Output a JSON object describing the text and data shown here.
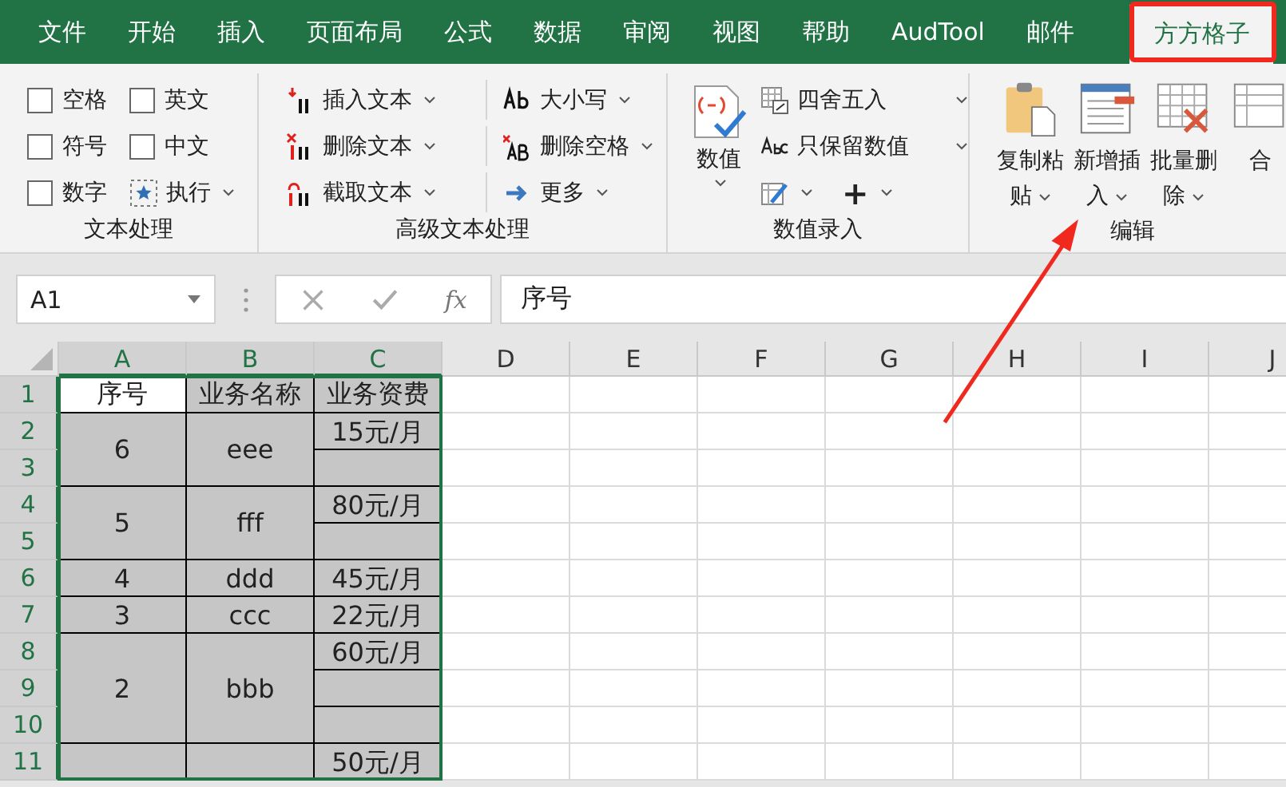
{
  "menu_tabs": [
    {
      "label": "文件",
      "selected": false
    },
    {
      "label": "开始",
      "selected": false
    },
    {
      "label": "插入",
      "selected": false
    },
    {
      "label": "页面布局",
      "selected": false
    },
    {
      "label": "公式",
      "selected": false
    },
    {
      "label": "数据",
      "selected": false
    },
    {
      "label": "审阅",
      "selected": false
    },
    {
      "label": "视图",
      "selected": false
    },
    {
      "label": "帮助",
      "selected": false
    },
    {
      "label": "AudTool",
      "selected": false
    },
    {
      "label": "邮件",
      "selected": false
    },
    {
      "label": "方方格子",
      "selected": true
    }
  ],
  "ribbon": {
    "text_group": {
      "title": "文本处理",
      "items": [
        {
          "kind": "checkbox",
          "label": "空格",
          "checked": false
        },
        {
          "kind": "checkbox",
          "label": "英文",
          "checked": false
        },
        {
          "kind": "checkbox",
          "label": "符号",
          "checked": false
        },
        {
          "kind": "checkbox",
          "label": "中文",
          "checked": false
        },
        {
          "kind": "checkbox",
          "label": "数字",
          "checked": false
        },
        {
          "kind": "button",
          "label": "执行"
        }
      ]
    },
    "advanced_group": {
      "title": "高级文本处理",
      "items": [
        {
          "label": "插入文本"
        },
        {
          "label": "大小写"
        },
        {
          "label": "删除文本"
        },
        {
          "label": "删除空格"
        },
        {
          "label": "截取文本"
        },
        {
          "label": "更多"
        }
      ]
    },
    "number_group": {
      "title": "数值录入",
      "big_button": "数值",
      "items": [
        {
          "kind": "text",
          "label": "四舍五入"
        },
        {
          "kind": "text",
          "label": "只保留数值"
        },
        {
          "kind": "icon"
        },
        {
          "kind": "glyph",
          "label": "+"
        }
      ]
    },
    "edit_group": {
      "title": "编辑",
      "buttons": [
        "复制粘贴",
        "新增插入",
        "批量删除",
        "合"
      ]
    }
  },
  "formula_bar": {
    "name_box": "A1",
    "fx": "fx",
    "formula": "序号"
  },
  "sheet": {
    "columns": [
      {
        "label": "A",
        "selected": true
      },
      {
        "label": "B",
        "selected": true
      },
      {
        "label": "C",
        "selected": true
      },
      {
        "label": "D",
        "selected": false
      },
      {
        "label": "E",
        "selected": false
      },
      {
        "label": "F",
        "selected": false
      },
      {
        "label": "G",
        "selected": false
      },
      {
        "label": "H",
        "selected": false
      },
      {
        "label": "I",
        "selected": false
      },
      {
        "label": "J",
        "selected": false
      }
    ],
    "rows": [
      {
        "label": "1",
        "selected": true
      },
      {
        "label": "2",
        "selected": true
      },
      {
        "label": "3",
        "selected": true
      },
      {
        "label": "4",
        "selected": true
      },
      {
        "label": "5",
        "selected": true
      },
      {
        "label": "6",
        "selected": true
      },
      {
        "label": "7",
        "selected": true
      },
      {
        "label": "8",
        "selected": true
      },
      {
        "label": "9",
        "selected": true
      },
      {
        "label": "10",
        "selected": true
      },
      {
        "label": "11",
        "selected": true
      }
    ],
    "headers": [
      {
        "text": "序号",
        "active": true
      },
      {
        "text": "业务名称",
        "active": false
      },
      {
        "text": "业务资费",
        "active": false
      }
    ],
    "records": [
      {
        "no": "6",
        "name": "eee",
        "fees": [
          {
            "kind": "text",
            "text": "15元/月"
          },
          {
            "kind": "empty"
          }
        ]
      },
      {
        "no": "5",
        "name": "fff",
        "fees": [
          {
            "kind": "text",
            "text": "80元/月"
          },
          {
            "kind": "empty"
          }
        ]
      },
      {
        "no": "4",
        "name": "ddd",
        "fees": [
          {
            "kind": "text",
            "text": "45元/月"
          }
        ]
      },
      {
        "no": "3",
        "name": "ccc",
        "fees": [
          {
            "kind": "text",
            "text": "22元/月"
          }
        ]
      },
      {
        "no": "2",
        "name": "bbb",
        "fees": [
          {
            "kind": "text",
            "text": "60元/月"
          },
          {
            "kind": "empty"
          },
          {
            "kind": "empty"
          }
        ]
      },
      {
        "fees": [
          {
            "kind": "text",
            "text": "50元/月"
          }
        ]
      }
    ]
  }
}
